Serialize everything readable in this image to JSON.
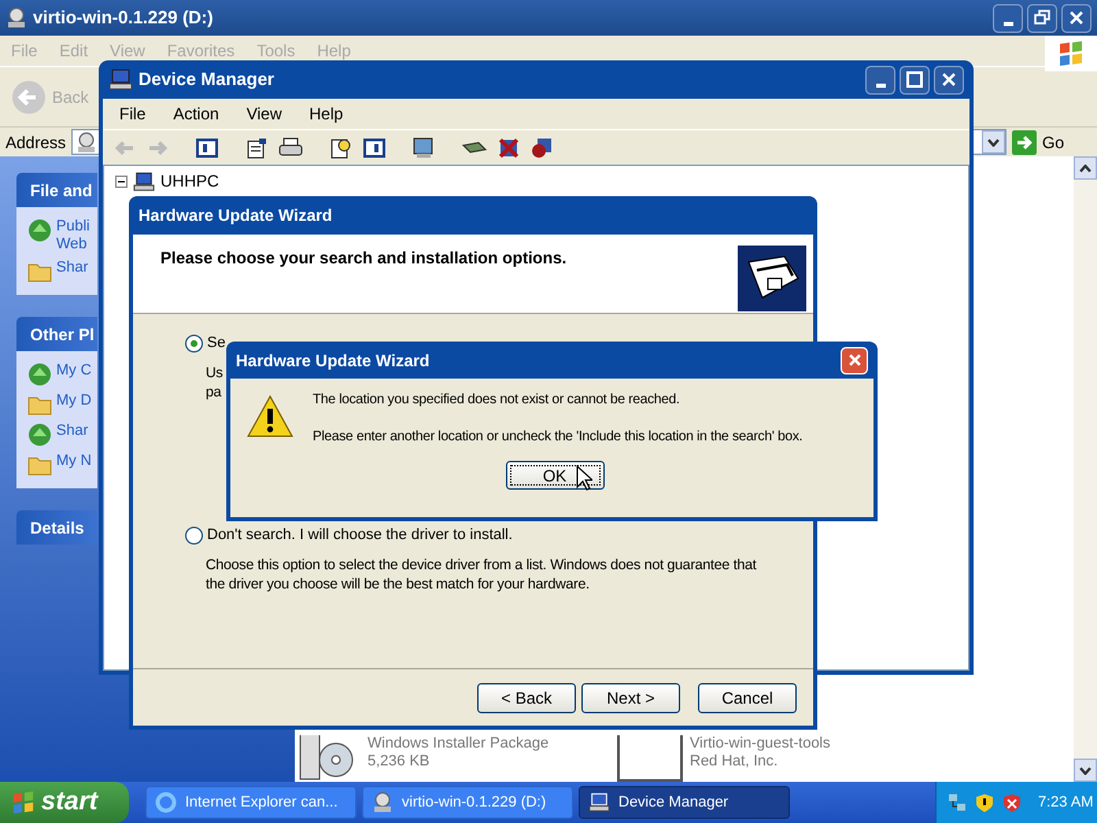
{
  "explorer": {
    "title": "virtio-win-0.1.229 (D:)",
    "menu": [
      "File",
      "Edit",
      "View",
      "Favorites",
      "Tools",
      "Help"
    ],
    "back": "Back",
    "address_label": "Address",
    "go": "Go",
    "sidebar": [
      {
        "title": "File and",
        "items": [
          {
            "lines": [
              "Publi",
              "Web"
            ]
          },
          {
            "lines": [
              "Shar"
            ]
          }
        ]
      },
      {
        "title": "Other Pl",
        "items": [
          {
            "lines": [
              "My C"
            ]
          },
          {
            "lines": [
              "My D"
            ]
          },
          {
            "lines": [
              "Shar"
            ]
          },
          {
            "lines": [
              "My N"
            ]
          }
        ]
      },
      {
        "title": "Details"
      }
    ],
    "files": [
      {
        "kind": "installer",
        "name": "Windows Installer Package",
        "detail": "5,236 KB"
      },
      {
        "kind": "blank",
        "name": "Virtio-win-guest-tools",
        "detail": "Red Hat, Inc."
      }
    ]
  },
  "device_manager": {
    "title": "Device Manager",
    "menu": [
      "File",
      "Action",
      "View",
      "Help"
    ],
    "tree_root": "UHHPC"
  },
  "wizard": {
    "title": "Hardware Update Wizard",
    "heading": "Please choose your search and installation options.",
    "options": [
      {
        "label": "Se",
        "description": [
          "Us",
          "pa"
        ],
        "selected": true
      },
      {
        "label": "Don't search. I will choose the driver to install.",
        "description": [
          "Choose this option to select the device driver from a list.  Windows does not guarantee that",
          "the driver you choose will be the best match for your hardware."
        ],
        "selected": false
      }
    ],
    "buttons": [
      "< Back",
      "Next >",
      "Cancel"
    ]
  },
  "dialog": {
    "title": "Hardware Update Wizard",
    "messages": [
      "The location you specified does not exist or cannot be reached.",
      "Please enter another location or uncheck the 'Include this location in the search' box."
    ],
    "button": "OK"
  },
  "taskbar": {
    "start": "start",
    "tasks": [
      {
        "kind": "browser",
        "label": "Internet Explorer can...",
        "selected": false
      },
      {
        "kind": "disc",
        "label": "virtio-win-0.1.229 (D:)",
        "selected": false
      },
      {
        "kind": "computer",
        "label": "Device Manager",
        "selected": true
      }
    ],
    "clock": "7:23 AM"
  }
}
